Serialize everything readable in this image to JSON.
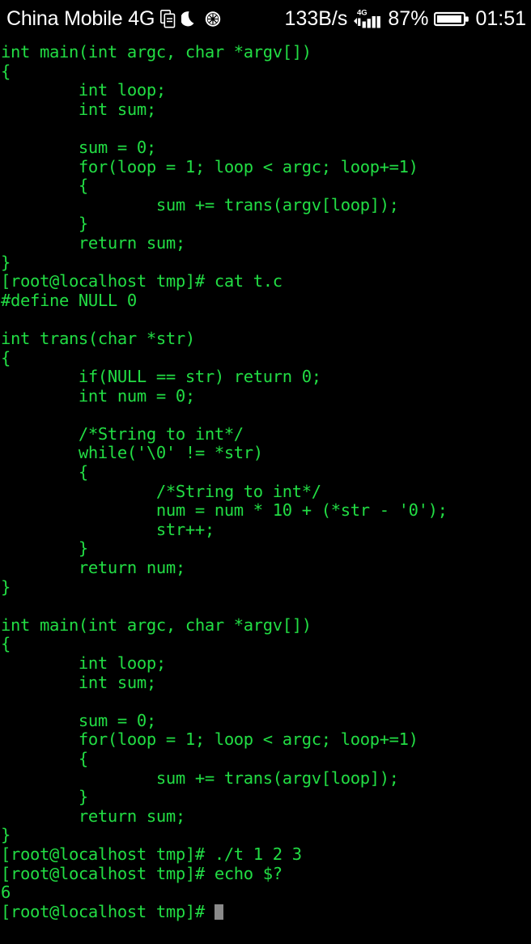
{
  "status_bar": {
    "carrier": "China Mobile 4G",
    "icons_left": [
      "documents-icon",
      "do-not-disturb-moon-icon",
      "spoked-wheel-icon"
    ],
    "network_rate": "133B/s",
    "network_type": "4G",
    "signal_icon": "signal-bars-icon",
    "battery_percent": "87%",
    "battery_icon": "battery-icon",
    "clock": "01:51",
    "text_color": "#ffffff",
    "background_color": "#000000"
  },
  "terminal": {
    "background_color": "#000000",
    "text_color": "#22dd44",
    "cursor_color": "#8a8a8a",
    "prompt": "[root@localhost tmp]#",
    "lines": [
      "int main(int argc, char *argv[])",
      "{",
      "        int loop;",
      "        int sum;",
      "",
      "        sum = 0;",
      "        for(loop = 1; loop < argc; loop+=1)",
      "        {",
      "                sum += trans(argv[loop]);",
      "        }",
      "        return sum;",
      "}",
      "[root@localhost tmp]# cat t.c",
      "#define NULL 0",
      "",
      "int trans(char *str)",
      "{",
      "        if(NULL == str) return 0;",
      "        int num = 0;",
      "",
      "        /*String to int*/",
      "        while('\\0' != *str)",
      "        {",
      "                /*String to int*/",
      "                num = num * 10 + (*str - '0');",
      "                str++;",
      "        }",
      "        return num;",
      "}",
      "",
      "int main(int argc, char *argv[])",
      "{",
      "        int loop;",
      "        int sum;",
      "",
      "        sum = 0;",
      "        for(loop = 1; loop < argc; loop+=1)",
      "        {",
      "                sum += trans(argv[loop]);",
      "        }",
      "        return sum;",
      "}",
      "[root@localhost tmp]# ./t 1 2 3",
      "[root@localhost tmp]# echo $?",
      "6"
    ],
    "last_line_prefix": "[root@localhost tmp]# ",
    "commands": [
      "cat t.c",
      "./t 1 2 3",
      "echo $?"
    ],
    "command_output": "6"
  }
}
